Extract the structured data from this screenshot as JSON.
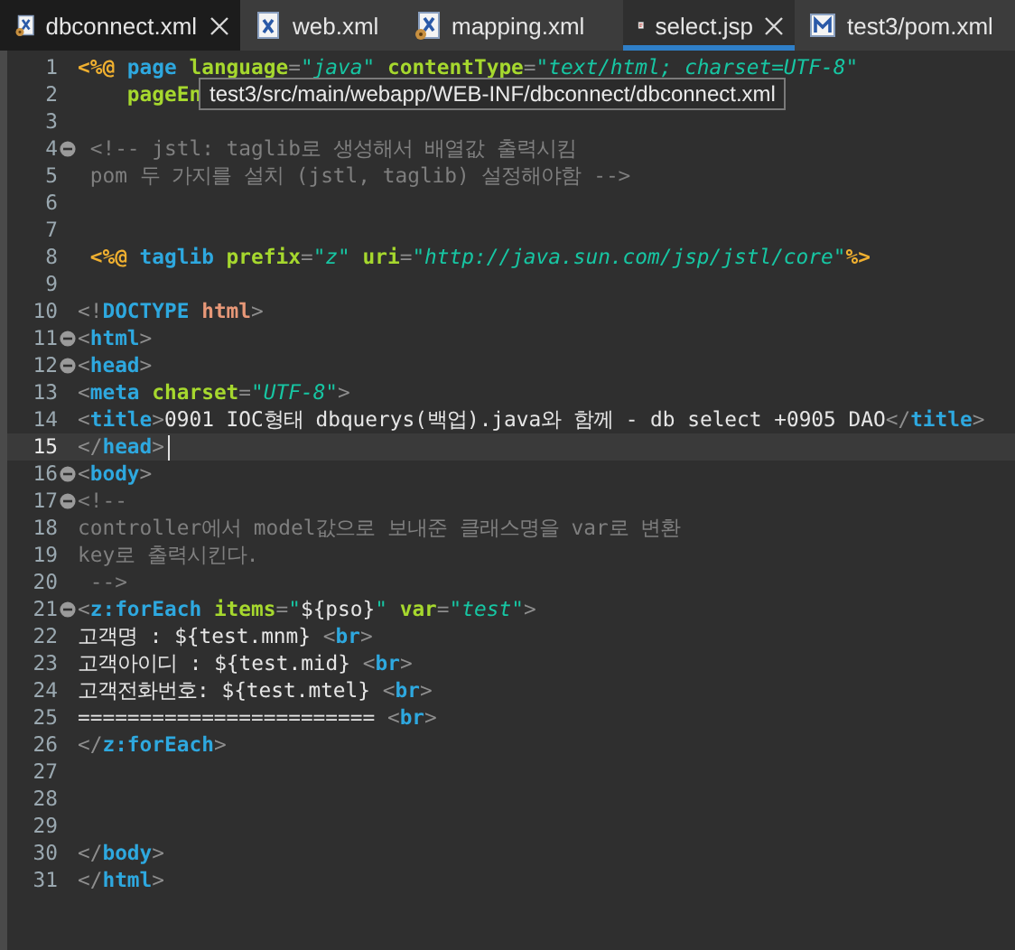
{
  "tabs": [
    {
      "label": "dbconnect.xml",
      "kind": "xml-config",
      "selected": false,
      "hovered": true,
      "closable": true
    },
    {
      "label": "web.xml",
      "kind": "xml",
      "selected": false,
      "hovered": false,
      "closable": false
    },
    {
      "label": "mapping.xml",
      "kind": "xml-config",
      "selected": false,
      "hovered": false,
      "closable": false
    },
    {
      "label": "select.jsp",
      "kind": "jsp",
      "selected": true,
      "hovered": false,
      "closable": true
    },
    {
      "label": "test3/pom.xml",
      "kind": "maven",
      "selected": false,
      "hovered": false,
      "closable": false
    }
  ],
  "tooltip": "test3/src/main/webapp/WEB-INF/dbconnect/dbconnect.xml",
  "lines": [
    {
      "number": "1",
      "fold": false,
      "current": false,
      "tokens": [
        {
          "kind": "directive",
          "text": "<%@"
        },
        {
          "kind": "keyword",
          "text": " page"
        },
        {
          "kind": "attr",
          "text": " language"
        },
        {
          "kind": "punct",
          "text": "="
        },
        {
          "kind": "string",
          "text": "\"java\""
        },
        {
          "kind": "attr",
          "text": " contentType"
        },
        {
          "kind": "punct",
          "text": "="
        },
        {
          "kind": "string",
          "text": "\"text/html; charset=UTF-8\""
        }
      ]
    },
    {
      "number": "2",
      "fold": false,
      "current": false,
      "tokens": [
        {
          "kind": "attr",
          "text": "    pageEn"
        }
      ]
    },
    {
      "number": "3",
      "fold": false,
      "current": false
    },
    {
      "number": "4",
      "fold": true,
      "current": false,
      "tokens": [
        {
          "kind": "comment",
          "text": " <!-- jstl: taglib로 생성해서 배열값 출력시킴"
        }
      ]
    },
    {
      "number": "5",
      "fold": false,
      "current": false,
      "tokens": [
        {
          "kind": "comment",
          "text": " pom 두 가지를 설치 (jstl, taglib) 설정해야함 -->"
        }
      ]
    },
    {
      "number": "6",
      "fold": false,
      "current": false
    },
    {
      "number": "7",
      "fold": false,
      "current": false
    },
    {
      "number": "8",
      "fold": false,
      "current": false,
      "tokens": [
        {
          "kind": "directive",
          "text": " <%@"
        },
        {
          "kind": "keyword",
          "text": " taglib"
        },
        {
          "kind": "attr",
          "text": " prefix"
        },
        {
          "kind": "punct",
          "text": "="
        },
        {
          "kind": "string",
          "text": "\"z\""
        },
        {
          "kind": "attr",
          "text": " uri"
        },
        {
          "kind": "punct",
          "text": "="
        },
        {
          "kind": "string",
          "text": "\"http://java.sun.com/jsp/jstl/core\""
        },
        {
          "kind": "directive",
          "text": "%>"
        }
      ]
    },
    {
      "number": "9",
      "fold": false,
      "current": false
    },
    {
      "number": "10",
      "fold": false,
      "current": false,
      "tokens": [
        {
          "kind": "punct",
          "text": "<!"
        },
        {
          "kind": "tag",
          "text": "DOCTYPE"
        },
        {
          "kind": "doctype",
          "text": " html"
        },
        {
          "kind": "punct",
          "text": ">"
        }
      ]
    },
    {
      "number": "11",
      "fold": true,
      "current": false,
      "tokens": [
        {
          "kind": "punct",
          "text": "<"
        },
        {
          "kind": "tag",
          "text": "html"
        },
        {
          "kind": "punct",
          "text": ">"
        }
      ]
    },
    {
      "number": "12",
      "fold": true,
      "current": false,
      "tokens": [
        {
          "kind": "punct",
          "text": "<"
        },
        {
          "kind": "tag",
          "text": "head"
        },
        {
          "kind": "punct",
          "text": ">"
        }
      ]
    },
    {
      "number": "13",
      "fold": false,
      "current": false,
      "tokens": [
        {
          "kind": "punct",
          "text": "<"
        },
        {
          "kind": "tag",
          "text": "meta"
        },
        {
          "kind": "attr",
          "text": " charset"
        },
        {
          "kind": "punct",
          "text": "="
        },
        {
          "kind": "string",
          "text": "\"UTF-8\""
        },
        {
          "kind": "punct",
          "text": ">"
        }
      ]
    },
    {
      "number": "14",
      "fold": false,
      "current": false,
      "tokens": [
        {
          "kind": "punct",
          "text": "<"
        },
        {
          "kind": "tag",
          "text": "title"
        },
        {
          "kind": "punct",
          "text": ">"
        },
        {
          "kind": "text",
          "text": "0901 IOC형태 dbquerys(백업).java와 함께 - db select +0905 DAO"
        },
        {
          "kind": "punct",
          "text": "</"
        },
        {
          "kind": "tag",
          "text": "title"
        },
        {
          "kind": "punct",
          "text": ">"
        }
      ]
    },
    {
      "number": "15",
      "fold": false,
      "current": true,
      "tokens": [
        {
          "kind": "punct",
          "text": "</"
        },
        {
          "kind": "tag",
          "text": "head"
        },
        {
          "kind": "punct",
          "text": ">"
        }
      ]
    },
    {
      "number": "16",
      "fold": true,
      "current": false,
      "tokens": [
        {
          "kind": "punct",
          "text": "<"
        },
        {
          "kind": "tag",
          "text": "body"
        },
        {
          "kind": "punct",
          "text": ">"
        }
      ]
    },
    {
      "number": "17",
      "fold": true,
      "current": false,
      "tokens": [
        {
          "kind": "comment",
          "text": "<!--"
        }
      ]
    },
    {
      "number": "18",
      "fold": false,
      "current": false,
      "tokens": [
        {
          "kind": "comment",
          "text": "controller에서 model값으로 보내준 클래스명을 var로 변환"
        }
      ]
    },
    {
      "number": "19",
      "fold": false,
      "current": false,
      "tokens": [
        {
          "kind": "comment",
          "text": "key로 출력시킨다."
        }
      ]
    },
    {
      "number": "20",
      "fold": false,
      "current": false,
      "tokens": [
        {
          "kind": "comment",
          "text": " -->"
        }
      ]
    },
    {
      "number": "21",
      "fold": true,
      "current": false,
      "tokens": [
        {
          "kind": "punct",
          "text": "<"
        },
        {
          "kind": "tag",
          "text": "z:forEach"
        },
        {
          "kind": "attr",
          "text": " items"
        },
        {
          "kind": "punct",
          "text": "="
        },
        {
          "kind": "string",
          "text": "\""
        },
        {
          "kind": "text",
          "text": "${pso}"
        },
        {
          "kind": "string",
          "text": "\""
        },
        {
          "kind": "attr",
          "text": " var"
        },
        {
          "kind": "punct",
          "text": "="
        },
        {
          "kind": "string",
          "text": "\"test\""
        },
        {
          "kind": "punct",
          "text": ">"
        }
      ]
    },
    {
      "number": "22",
      "fold": false,
      "current": false,
      "tokens": [
        {
          "kind": "text",
          "text": "고객명 : ${test.mnm} "
        },
        {
          "kind": "punct",
          "text": "<"
        },
        {
          "kind": "tag",
          "text": "br"
        },
        {
          "kind": "punct",
          "text": ">"
        }
      ]
    },
    {
      "number": "23",
      "fold": false,
      "current": false,
      "tokens": [
        {
          "kind": "text",
          "text": "고객아이디 : ${test.mid} "
        },
        {
          "kind": "punct",
          "text": "<"
        },
        {
          "kind": "tag",
          "text": "br"
        },
        {
          "kind": "punct",
          "text": ">"
        }
      ]
    },
    {
      "number": "24",
      "fold": false,
      "current": false,
      "tokens": [
        {
          "kind": "text",
          "text": "고객전화번호: ${test.mtel} "
        },
        {
          "kind": "punct",
          "text": "<"
        },
        {
          "kind": "tag",
          "text": "br"
        },
        {
          "kind": "punct",
          "text": ">"
        }
      ]
    },
    {
      "number": "25",
      "fold": false,
      "current": false,
      "tokens": [
        {
          "kind": "text",
          "text": "======================== "
        },
        {
          "kind": "punct",
          "text": "<"
        },
        {
          "kind": "tag",
          "text": "br"
        },
        {
          "kind": "punct",
          "text": ">"
        }
      ]
    },
    {
      "number": "26",
      "fold": false,
      "current": false,
      "tokens": [
        {
          "kind": "punct",
          "text": "</"
        },
        {
          "kind": "tag",
          "text": "z:forEach"
        },
        {
          "kind": "punct",
          "text": ">"
        }
      ]
    },
    {
      "number": "27",
      "fold": false,
      "current": false
    },
    {
      "number": "28",
      "fold": false,
      "current": false
    },
    {
      "number": "29",
      "fold": false,
      "current": false
    },
    {
      "number": "30",
      "fold": false,
      "current": false,
      "tokens": [
        {
          "kind": "punct",
          "text": "</"
        },
        {
          "kind": "tag",
          "text": "body"
        },
        {
          "kind": "punct",
          "text": ">"
        }
      ]
    },
    {
      "number": "31",
      "fold": false,
      "current": false,
      "tokens": [
        {
          "kind": "punct",
          "text": "</"
        },
        {
          "kind": "tag",
          "text": "html"
        },
        {
          "kind": "punct",
          "text": ">"
        }
      ]
    }
  ]
}
